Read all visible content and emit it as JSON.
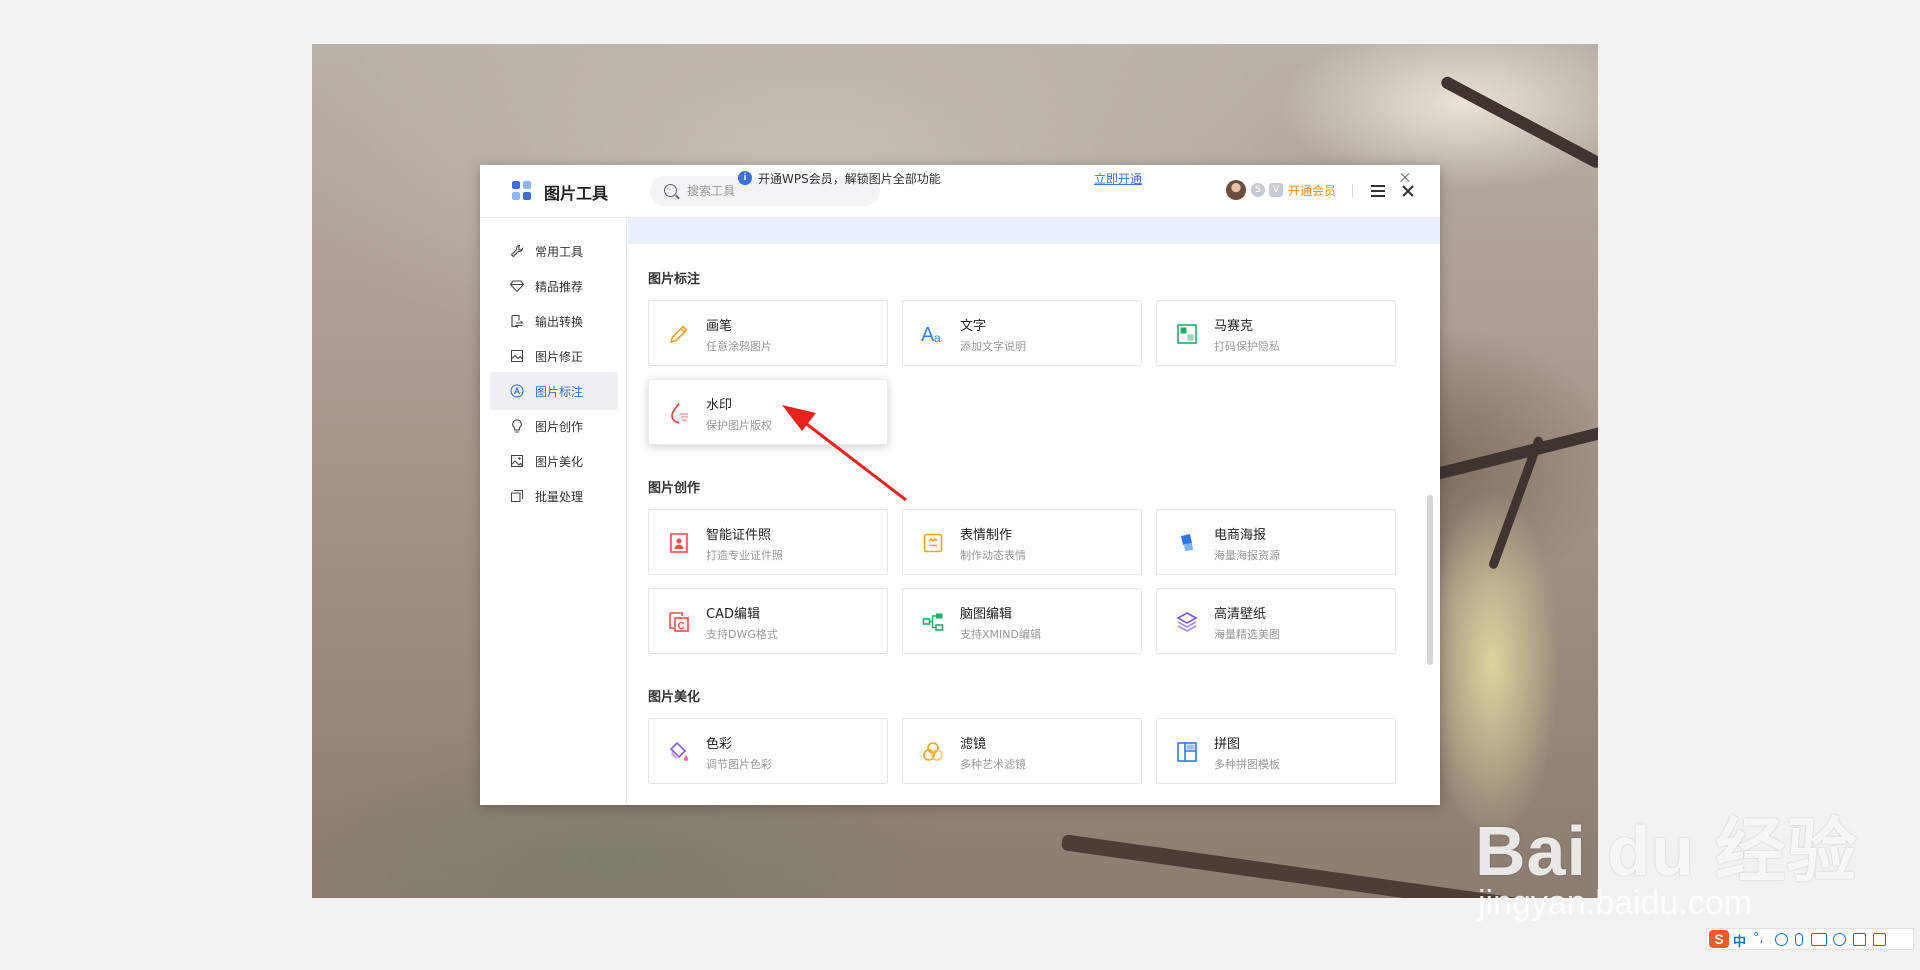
{
  "app": {
    "title": "图片工具",
    "search_placeholder": "搜索工具",
    "vip_label": "开通会员",
    "badge_s": "S",
    "badge_v": "V"
  },
  "notice": {
    "text": "开通WPS会员，解锁图片全部功能",
    "link": "立即开通",
    "icon": "info-icon"
  },
  "sidebar": {
    "items": [
      {
        "label": "常用工具",
        "icon": "wrench-icon"
      },
      {
        "label": "精品推荐",
        "icon": "diamond-icon"
      },
      {
        "label": "输出转换",
        "icon": "convert-icon"
      },
      {
        "label": "图片修正",
        "icon": "image-fix-icon"
      },
      {
        "label": "图片标注",
        "icon": "annotate-icon",
        "active": true
      },
      {
        "label": "图片创作",
        "icon": "bulb-icon"
      },
      {
        "label": "图片美化",
        "icon": "image-beautify-icon"
      },
      {
        "label": "批量处理",
        "icon": "batch-icon"
      }
    ]
  },
  "sections": [
    {
      "title": "图片标注",
      "tools": [
        {
          "title": "画笔",
          "desc": "任意涂鸦图片",
          "icon": "pen-icon"
        },
        {
          "title": "文字",
          "desc": "添加文字说明",
          "icon": "text-icon"
        },
        {
          "title": "马赛克",
          "desc": "打码保护隐私",
          "icon": "mosaic-icon"
        },
        {
          "title": "水印",
          "desc": "保护图片版权",
          "icon": "watermark-icon"
        }
      ]
    },
    {
      "title": "图片创作",
      "tools": [
        {
          "title": "智能证件照",
          "desc": "打造专业证件照",
          "icon": "id-photo-icon"
        },
        {
          "title": "表情制作",
          "desc": "制作动态表情",
          "icon": "emoji-icon"
        },
        {
          "title": "电商海报",
          "desc": "海量海报资源",
          "icon": "poster-icon"
        },
        {
          "title": "CAD编辑",
          "desc": "支持DWG格式",
          "icon": "cad-icon"
        },
        {
          "title": "脑图编辑",
          "desc": "支持XMIND编辑",
          "icon": "mindmap-icon"
        },
        {
          "title": "高清壁纸",
          "desc": "海量精选美图",
          "icon": "wallpaper-icon"
        }
      ]
    },
    {
      "title": "图片美化",
      "tools": [
        {
          "title": "色彩",
          "desc": "调节图片色彩",
          "icon": "color-icon"
        },
        {
          "title": "滤镜",
          "desc": "多种艺术滤镜",
          "icon": "filter-icon"
        },
        {
          "title": "拼图",
          "desc": "多种拼图模板",
          "icon": "collage-icon"
        }
      ]
    }
  ],
  "watermark": {
    "main": "Bai du 经验",
    "sub": "jingyan.baidu.com"
  },
  "ime": {
    "logo": "S",
    "lang": "中",
    "punct": "°,"
  },
  "colors": {
    "accent": "#3b6fe0",
    "vip": "#e8902a",
    "arrow": "#e8231b"
  }
}
